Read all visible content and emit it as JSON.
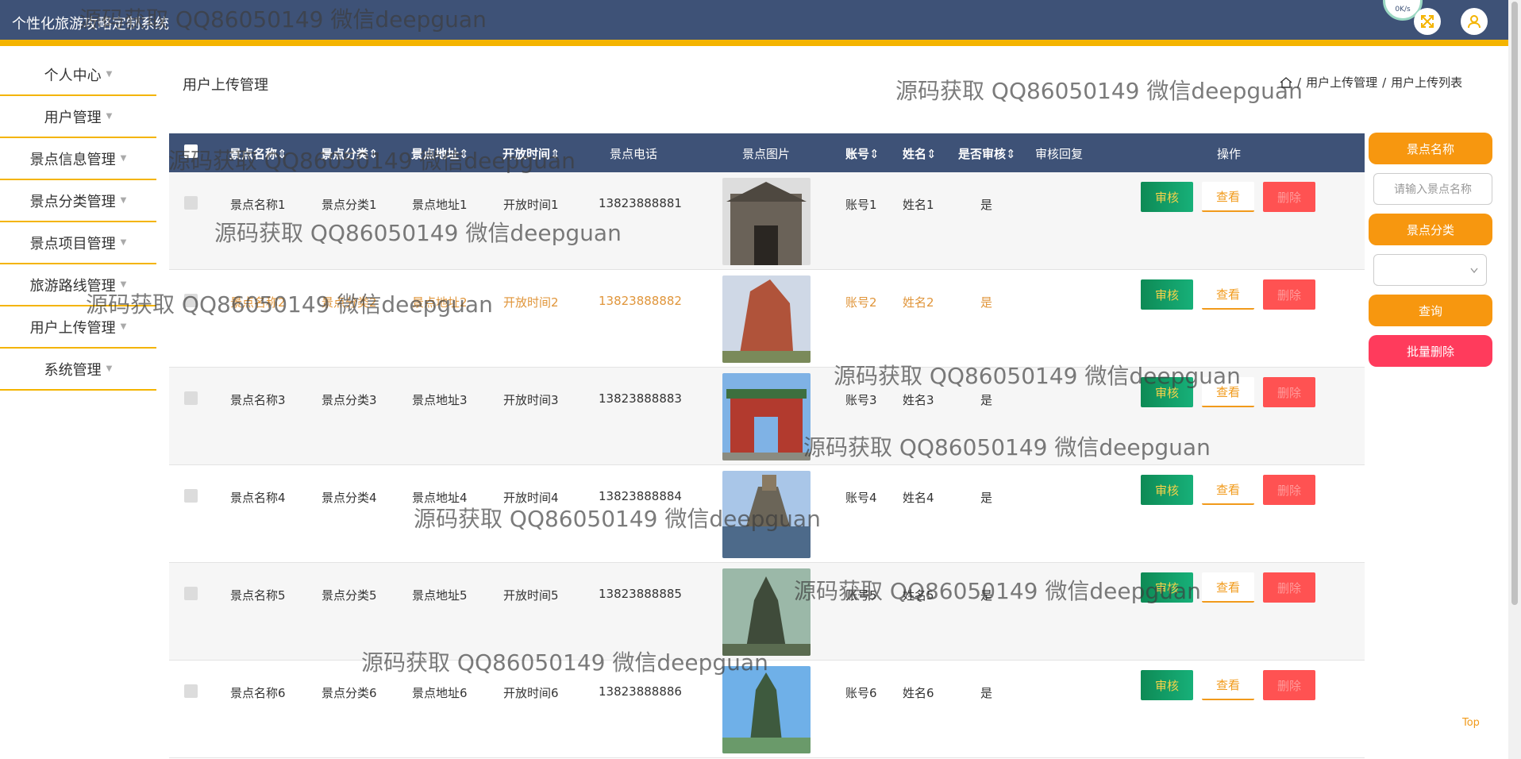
{
  "app": {
    "title": "个性化旅游攻略定制系统"
  },
  "speed": "0K/s",
  "sidebar": {
    "items": [
      {
        "label": "个人中心"
      },
      {
        "label": "用户管理"
      },
      {
        "label": "景点信息管理"
      },
      {
        "label": "景点分类管理"
      },
      {
        "label": "景点项目管理"
      },
      {
        "label": "旅游路线管理"
      },
      {
        "label": "用户上传管理"
      },
      {
        "label": "系统管理"
      }
    ]
  },
  "page": {
    "title": "用户上传管理"
  },
  "breadcrumb": {
    "level1": "用户上传管理",
    "level2": "用户上传列表"
  },
  "table": {
    "headers": [
      "景点名称",
      "景点分类",
      "景点地址",
      "开放时间",
      "景点电话",
      "景点图片",
      "账号",
      "姓名",
      "是否审核",
      "审核回复",
      "操作"
    ],
    "rows": [
      {
        "name": "景点名称1",
        "category": "景点分类1",
        "address": "景点地址1",
        "hours": "开放时间1",
        "phone": "13823888881",
        "account": "账号1",
        "username": "姓名1",
        "reviewed": "是",
        "reply": ""
      },
      {
        "name": "景点名称2",
        "category": "景点分类2",
        "address": "景点地址2",
        "hours": "开放时间2",
        "phone": "13823888882",
        "account": "账号2",
        "username": "姓名2",
        "reviewed": "是",
        "reply": ""
      },
      {
        "name": "景点名称3",
        "category": "景点分类3",
        "address": "景点地址3",
        "hours": "开放时间3",
        "phone": "13823888883",
        "account": "账号3",
        "username": "姓名3",
        "reviewed": "是",
        "reply": ""
      },
      {
        "name": "景点名称4",
        "category": "景点分类4",
        "address": "景点地址4",
        "hours": "开放时间4",
        "phone": "13823888884",
        "account": "账号4",
        "username": "姓名4",
        "reviewed": "是",
        "reply": ""
      },
      {
        "name": "景点名称5",
        "category": "景点分类5",
        "address": "景点地址5",
        "hours": "开放时间5",
        "phone": "13823888885",
        "account": "账号5",
        "username": "姓名5",
        "reviewed": "是",
        "reply": ""
      },
      {
        "name": "景点名称6",
        "category": "景点分类6",
        "address": "景点地址6",
        "hours": "开放时间6",
        "phone": "13823888886",
        "account": "账号6",
        "username": "姓名6",
        "reviewed": "是",
        "reply": ""
      }
    ],
    "actions": {
      "audit": "审核",
      "view": "查看",
      "delete": "删除"
    }
  },
  "search": {
    "name_label": "景点名称",
    "name_placeholder": "请输入景点名称",
    "category_label": "景点分类",
    "query_button": "查询",
    "batch_delete_button": "批量删除"
  },
  "top_link": "Top",
  "watermark": "源码获取 QQ86050149 微信deepguan",
  "colors": {
    "header": "#3e5277",
    "accent": "#f4b400",
    "orange": "#f7970f",
    "danger": "#ff5252",
    "success": "#0e8a55"
  }
}
